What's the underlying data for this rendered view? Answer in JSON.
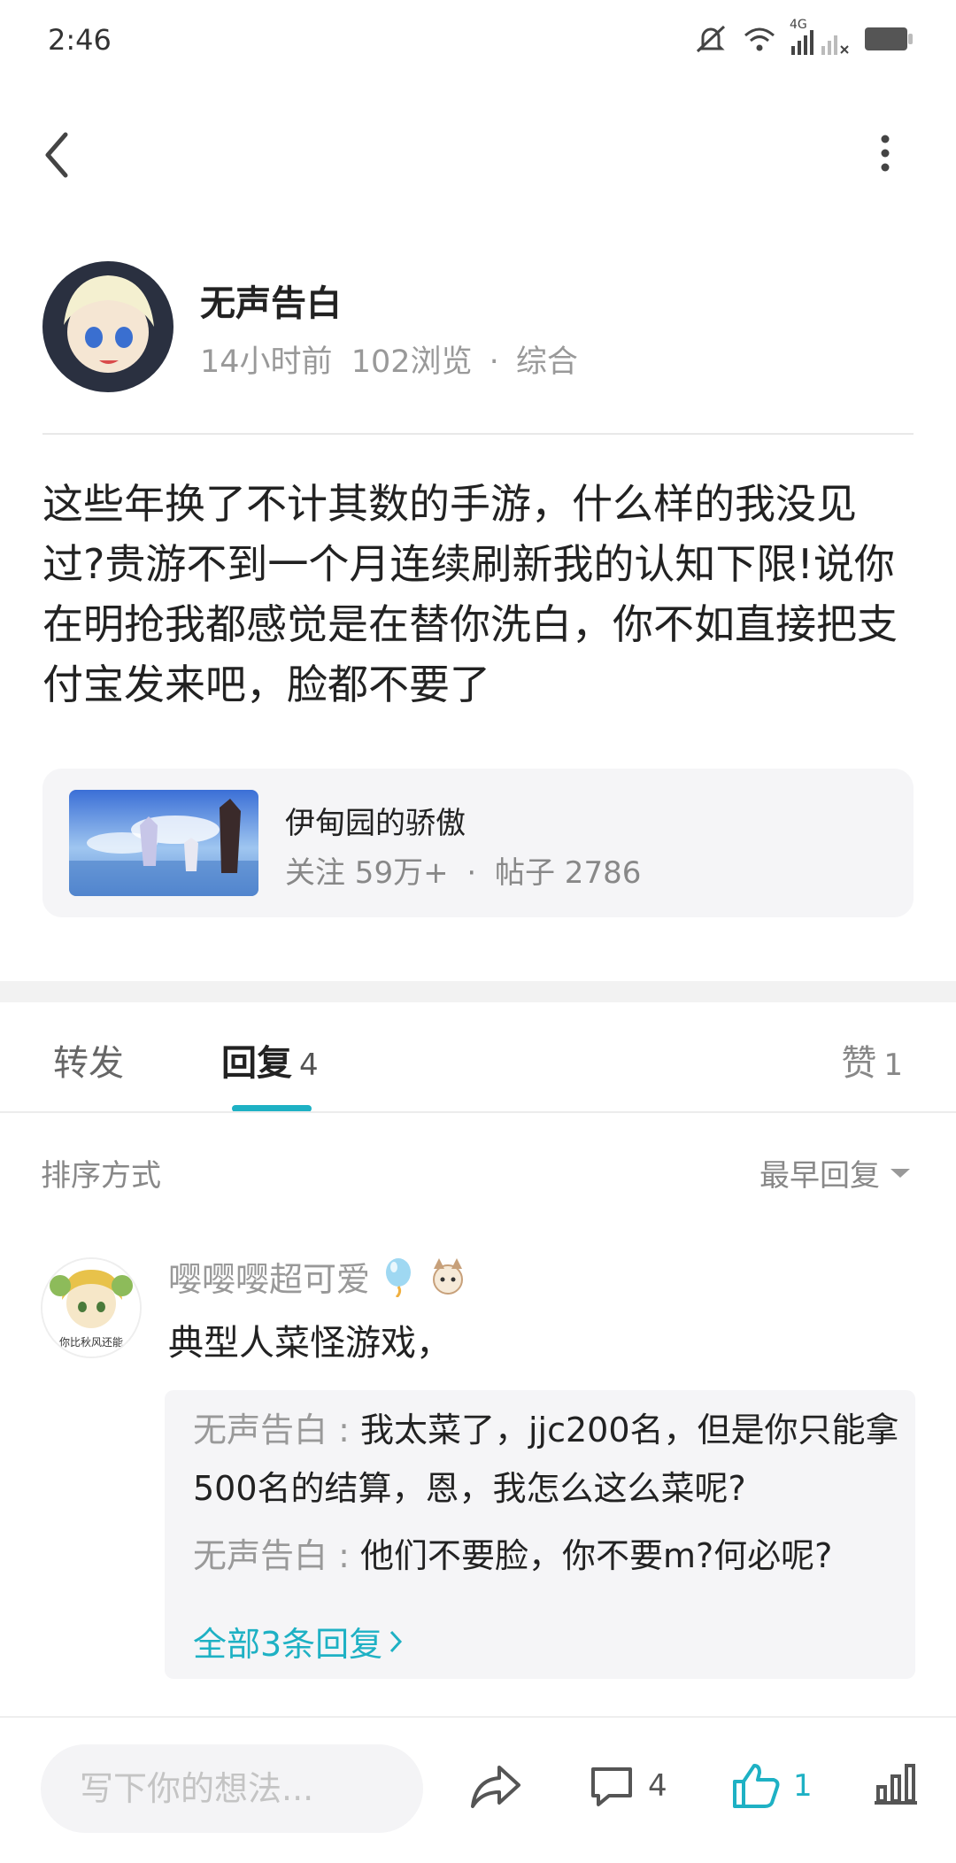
{
  "status_bar": {
    "time": "2:46",
    "network": "4G"
  },
  "post": {
    "author": "无声告白",
    "time_ago": "14小时前",
    "views": "102浏览",
    "category": "综合",
    "body": "这些年换了不计其数的手游，什么样的我没见过?贵游不到一个月连续刷新我的认知下限!说你在明抢我都感觉是在替你洗白，你不如直接把支付宝发来吧，脸都不要了"
  },
  "forum": {
    "name": "伊甸园的骄傲",
    "followers": "关注 59万+",
    "posts": "帖子 2786",
    "separator": "·"
  },
  "tabs": {
    "repost": "转发",
    "reply": "回复",
    "reply_count": "4",
    "like": "赞",
    "like_count": "1"
  },
  "sort": {
    "label": "排序方式",
    "selected": "最早回复"
  },
  "comment": {
    "author": "嘤嘤嘤超可爱",
    "avatar_caption": "你比秋风还能",
    "text": "典型人菜怪游戏，",
    "replies": [
      {
        "who": "无声告白",
        "sep": " : ",
        "text": "我太菜了，jjc200名，但是你只能拿500名的结算，恩，我怎么这么菜呢?"
      },
      {
        "who": "无声告白",
        "sep": " : ",
        "text": "他们不要脸，你不要m?何必呢?"
      }
    ],
    "more_replies": "全部3条回复"
  },
  "bottom_bar": {
    "input_placeholder": "写下你的想法...",
    "comment_count": "4",
    "like_count": "1"
  },
  "colors": {
    "accent": "#1eb1c4",
    "muted": "#999999"
  }
}
